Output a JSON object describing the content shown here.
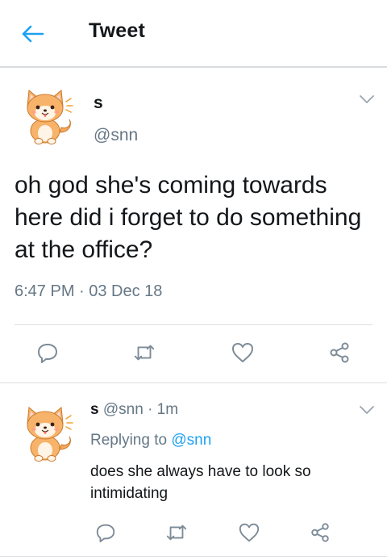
{
  "header": {
    "title": "Tweet",
    "back_icon": "arrow-left-icon",
    "accent_color": "#1da1f2"
  },
  "main_tweet": {
    "name": "s",
    "handle": "@snn",
    "text": "oh god she's coming towards here did i forget to do something at the office?",
    "timestamp": "6:47 PM · 03 Dec 18",
    "avatar": "shiba-dog-avatar",
    "actions": [
      "reply-icon",
      "retweet-icon",
      "like-icon",
      "share-icon"
    ]
  },
  "reply": {
    "name": "s",
    "handle": "@snn",
    "dot": "·",
    "age": "1m",
    "replying_prefix": "Replying to",
    "replying_handle": "@snn",
    "text": "does she always have to look so intimidating",
    "avatar": "shiba-dog-avatar",
    "actions": [
      "reply-icon",
      "retweet-icon",
      "like-icon",
      "share-icon"
    ]
  },
  "colors": {
    "text_primary": "#14171a",
    "text_secondary": "#657786",
    "link": "#1da1f2",
    "divider": "#dcdfe3"
  }
}
